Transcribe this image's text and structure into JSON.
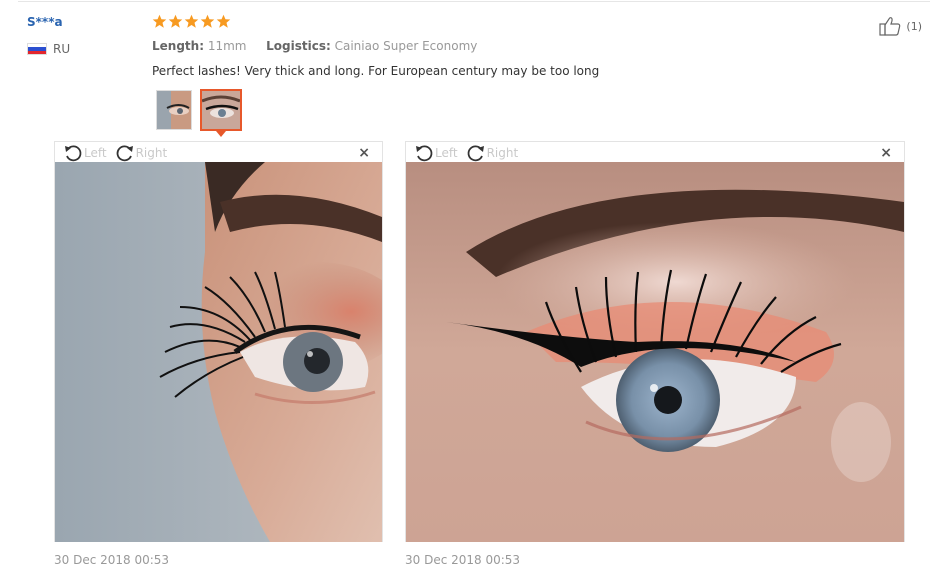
{
  "review": {
    "user_name": "S***a",
    "country": "RU",
    "rating": 5,
    "length_label": "Length:",
    "length_value": "11mm",
    "logistics_label": "Logistics:",
    "logistics_value": "Cainiao Super Economy",
    "text": "Perfect lashes! Very thick and long. For European century may be too long",
    "helpful_count": "(1)",
    "colors": {
      "star": "#f79a21",
      "active_border": "#e7582b",
      "name": "#2a64b0"
    }
  },
  "viewers": [
    {
      "rotate_left_label": "Left",
      "rotate_right_label": "Right",
      "close_label": "×",
      "date": "30 Dec 2018 00:53"
    },
    {
      "rotate_left_label": "Left",
      "rotate_right_label": "Right",
      "close_label": "×",
      "date": "30 Dec 2018 00:53"
    }
  ]
}
